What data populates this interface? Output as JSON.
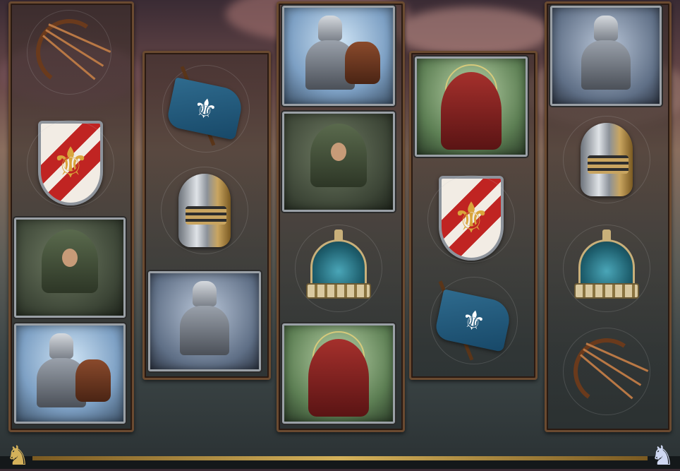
{
  "game": {
    "reels": [
      {
        "id": 1,
        "symbols": [
          "crossbow",
          "shield-fleur-de-lis",
          "hooded-archer",
          "mounted-knight"
        ]
      },
      {
        "id": 2,
        "symbols": [
          "blue-fleur-de-lis-flag",
          "gold-visor-helmet",
          "armored-knight"
        ]
      },
      {
        "id": 3,
        "symbols": [
          "mounted-knight",
          "hooded-archer",
          "ornate-crown",
          "red-hooded-monk"
        ]
      },
      {
        "id": 4,
        "symbols": [
          "red-hooded-monk",
          "shield-fleur-de-lis",
          "blue-fleur-de-lis-flag"
        ]
      },
      {
        "id": 5,
        "symbols": [
          "armored-knight",
          "gold-visor-helmet",
          "ornate-crown",
          "crossbow"
        ]
      }
    ]
  },
  "colors": {
    "frame": "#6a4a30",
    "tile_border": "#9aa0a6",
    "gold": "#d4b15a",
    "shield_red": "#c02422",
    "flag_blue": "#2f6b8e"
  },
  "icons": {
    "fleur": "⚜",
    "horseman": "♞"
  }
}
